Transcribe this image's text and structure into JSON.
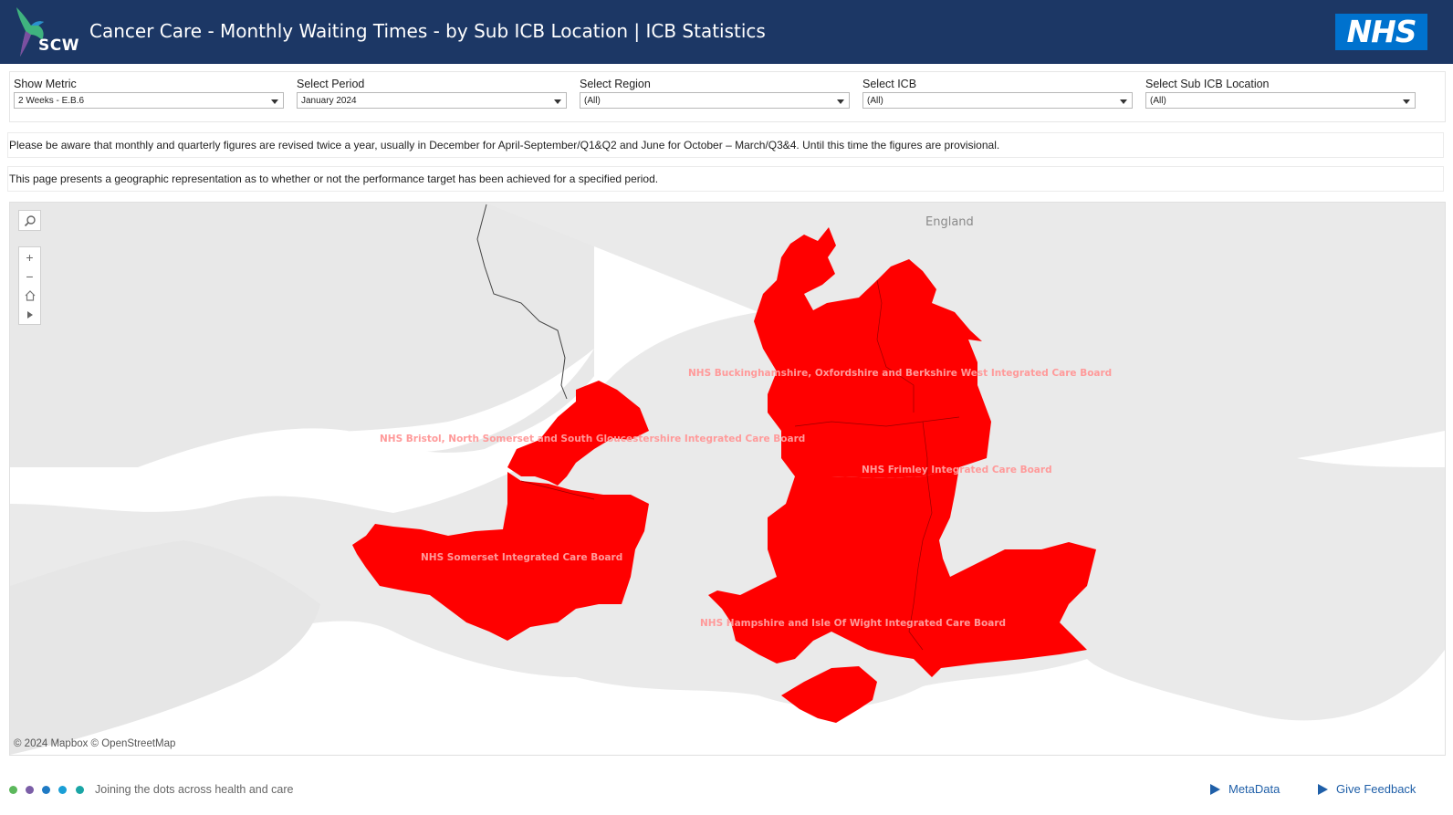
{
  "header": {
    "logo_text": "SCW",
    "title": "Cancer Care - Monthly Waiting Times - by Sub ICB Location | ICB Statistics",
    "nhs_logo": "NHS"
  },
  "filters": [
    {
      "label": "Show Metric",
      "value": "2 Weeks - E.B.6"
    },
    {
      "label": "Select Period",
      "value": "January 2024"
    },
    {
      "label": "Select Region",
      "value": "(All)"
    },
    {
      "label": "Select ICB",
      "value": "(All)"
    },
    {
      "label": "Select Sub ICB Location",
      "value": "(All)"
    }
  ],
  "notices": [
    "Please be aware that monthly and quarterly figures are revised twice a year, usually in December for April-September/Q1&Q2 and June for October – March/Q3&4.  Until this time the figures are provisional.",
    "This page presents a geographic representation as to whether or not the performance target has been achieved for a specified period."
  ],
  "map": {
    "place_label": "England",
    "region_color": "#ff0000",
    "regions": [
      {
        "name": "NHS Buckinghamshire, Oxfordshire and Berkshire West Integrated Care Board"
      },
      {
        "name": "NHS Bristol, North Somerset and South Gloucestershire Integrated Care Board"
      },
      {
        "name": "NHS Frimley Integrated Care Board"
      },
      {
        "name": "NHS Somerset Integrated Care Board"
      },
      {
        "name": "NHS Hampshire and Isle Of Wight Integrated Care Board"
      }
    ],
    "attribution": "© 2024 Mapbox  © OpenStreetMap",
    "controls": [
      "search-icon",
      "zoom-in-icon",
      "zoom-out-icon",
      "home-icon",
      "expand-icon"
    ]
  },
  "footer": {
    "dot_colors": [
      "#5cb85c",
      "#7b5ea7",
      "#1f7ac4",
      "#1a9fd6",
      "#1aa5a5"
    ],
    "tagline": "Joining the dots across health and care",
    "links": [
      "MetaData",
      "Give Feedback"
    ]
  }
}
